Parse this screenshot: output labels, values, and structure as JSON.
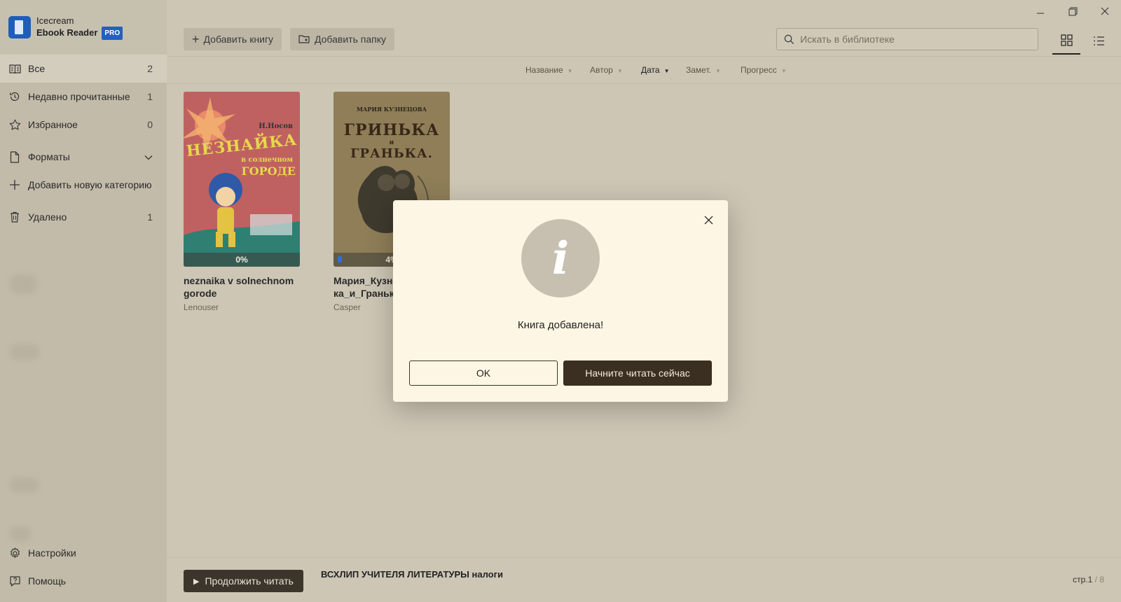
{
  "app": {
    "name_line1": "Icecream",
    "name_line2": "Ebook Reader",
    "badge": "PRO"
  },
  "sidebar": {
    "items": [
      {
        "label": "Все",
        "count": "2",
        "icon": "book-open-icon"
      },
      {
        "label": "Недавно прочитанные",
        "count": "1",
        "icon": "history-icon"
      },
      {
        "label": "Избранное",
        "count": "0",
        "icon": "star-icon"
      },
      {
        "label": "Форматы",
        "icon": "file-icon"
      },
      {
        "label": "Добавить новую категорию",
        "icon": "plus-icon"
      },
      {
        "label": "Удалено",
        "count": "1",
        "icon": "trash-icon"
      }
    ],
    "bottom": [
      {
        "label": "Настройки",
        "icon": "gear-icon"
      },
      {
        "label": "Помощь",
        "icon": "help-icon"
      }
    ]
  },
  "toolbar": {
    "add_book": "Добавить книгу",
    "add_folder": "Добавить папку",
    "search_placeholder": "Искать в библиотеке"
  },
  "sort": {
    "columns": [
      "Название",
      "Автор",
      "Дата",
      "Замет.",
      "Прогресс"
    ],
    "active": "Дата"
  },
  "books": [
    {
      "title": "neznaika v solnechnom gorode",
      "author": "Lenouser",
      "progress": "0%",
      "cover_text": [
        "Н.Носов",
        "НЕЗНАЙКА",
        "в солнечном",
        "ГОРОДЕ"
      ]
    },
    {
      "title": "Мария_Кузне ка_и_Гранька",
      "author": "Casper",
      "progress": "4%",
      "cover_text": [
        "МАРИЯ КУЗНЕЦОВА",
        "ГРИНЬКА",
        "и",
        "ГРАНЬКА."
      ]
    }
  ],
  "bottombar": {
    "continue": "Продолжить читать",
    "now_reading": "ВСХЛИП УЧИТЕЛЯ ЛИТЕРАТУРЫ налоги",
    "page": "стр.1",
    "page_total": "/ 8"
  },
  "dialog": {
    "message": "Книга добавлена!",
    "ok": "OK",
    "read_now": "Начните читать сейчас"
  },
  "colors": {
    "accent": "#1f5db8",
    "primary_button": "#3b2f22",
    "dialog_bg": "#fdf6e4"
  }
}
